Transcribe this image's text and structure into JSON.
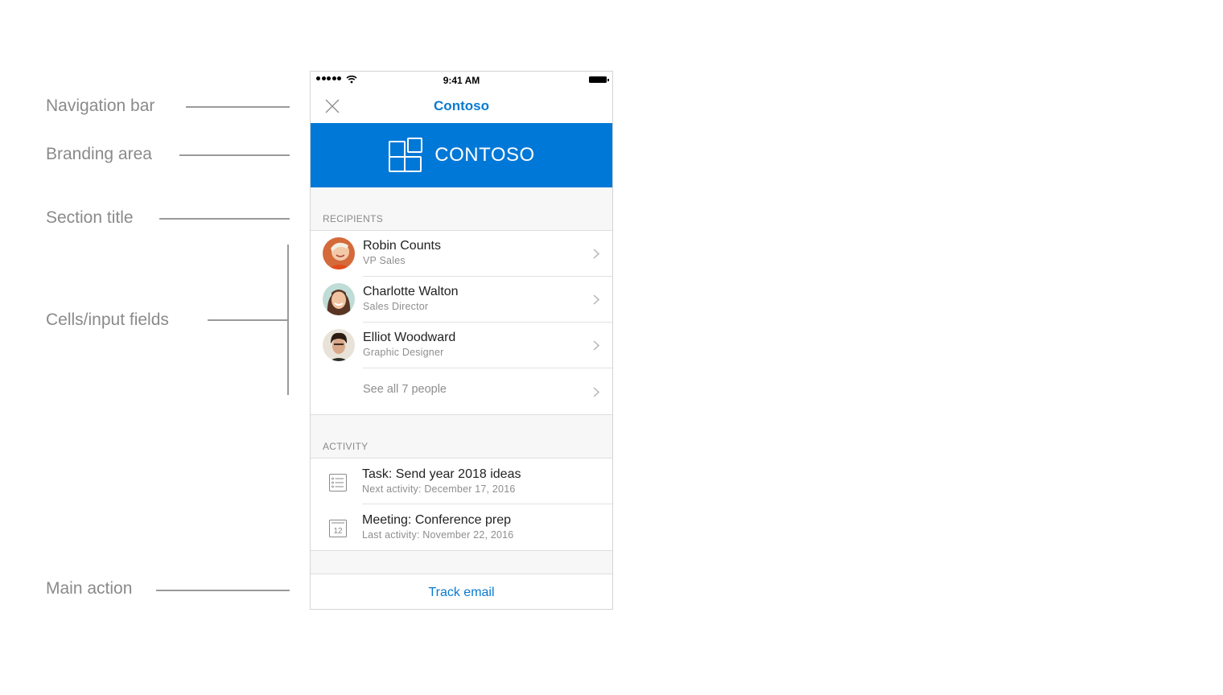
{
  "callouts": [
    {
      "label": "Navigation bar"
    },
    {
      "label": "Branding area"
    },
    {
      "label": "Section title"
    },
    {
      "label": "Cells/input fields"
    },
    {
      "label": "Main action"
    }
  ],
  "status_bar": {
    "time": "9:41 AM",
    "signal_icon": "signal-dots-icon",
    "wifi_icon": "wifi-icon",
    "battery_icon": "battery-icon"
  },
  "nav_bar": {
    "title": "Contoso",
    "close_icon": "close-icon"
  },
  "branding": {
    "name": "CONTOSO",
    "logo_icon": "contoso-logo-icon",
    "color": "#0078d7"
  },
  "accent_color": "#0a7ad0",
  "recipients": {
    "section_title": "RECIPIENTS",
    "people": [
      {
        "name": "Robin Counts",
        "title": "VP Sales"
      },
      {
        "name": "Charlotte Walton",
        "title": "Sales Director"
      },
      {
        "name": "Elliot Woodward",
        "title": "Graphic Designer"
      }
    ],
    "see_all_label": "See all 7 people"
  },
  "activity": {
    "section_title": "ACTIVITY",
    "items": [
      {
        "icon": "task-list-icon",
        "title": "Task: Send year 2018 ideas",
        "subtitle": "Next activity: December 17, 2016"
      },
      {
        "icon": "calendar-icon",
        "calendar_day": "12",
        "title": "Meeting: Conference prep",
        "subtitle": "Last activity: November 22, 2016"
      }
    ]
  },
  "main_action": {
    "label": "Track email"
  }
}
